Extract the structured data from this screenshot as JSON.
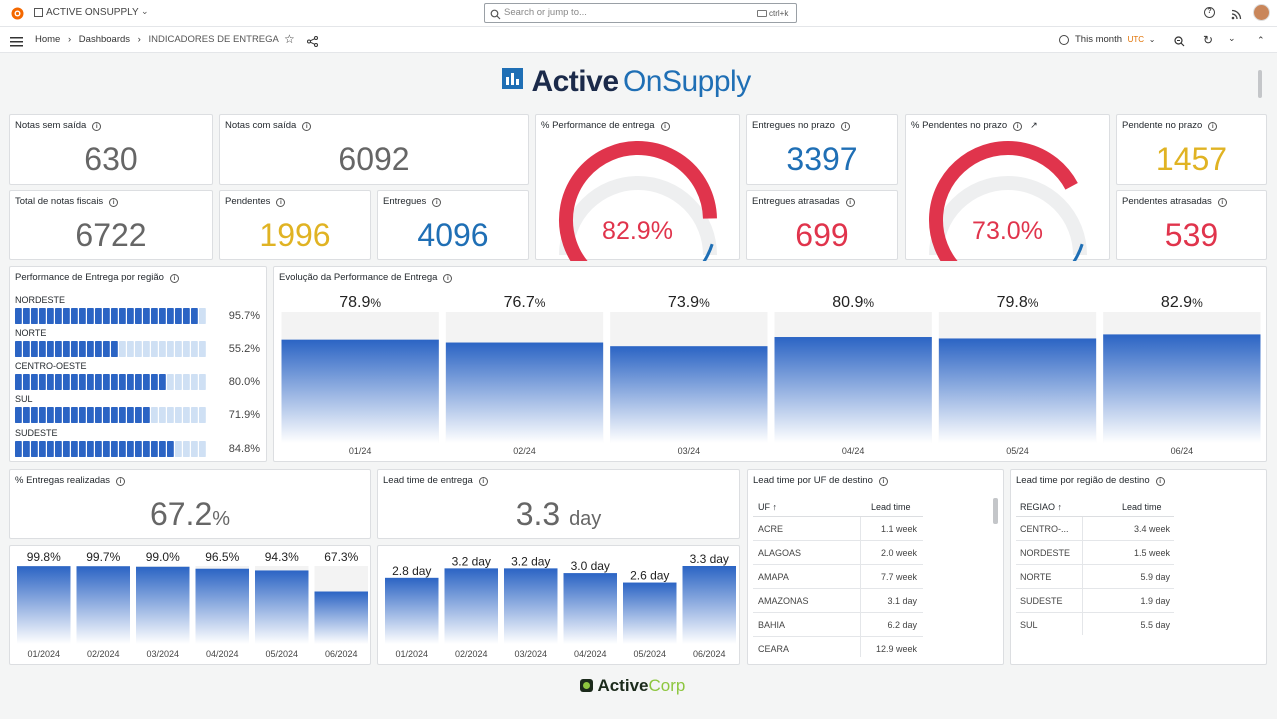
{
  "topbar": {
    "app_title": "ACTIVE ONSUPPLY",
    "search_placeholder": "Search or jump to...",
    "search_shortcut": "ctrl+k"
  },
  "navbar": {
    "breadcrumb": [
      "Home",
      "Dashboards",
      "INDICADORES DE ENTREGA"
    ],
    "time_range": "This month",
    "timezone": "UTC"
  },
  "header_logo": {
    "word1": "Active",
    "word2": "OnSupply"
  },
  "footer_logo": {
    "word1": "Active",
    "word2": "Corp"
  },
  "stats": {
    "notas_sem_saida": {
      "title": "Notas sem saída",
      "value": "630"
    },
    "notas_com_saida": {
      "title": "Notas com saída",
      "value": "6092"
    },
    "total_notas": {
      "title": "Total de notas fiscais",
      "value": "6722"
    },
    "pendentes": {
      "title": "Pendentes",
      "value": "1996"
    },
    "entregues": {
      "title": "Entregues",
      "value": "4096"
    },
    "entregues_no_prazo": {
      "title": "Entregues no prazo",
      "value": "3397"
    },
    "entregues_atrasadas": {
      "title": "Entregues atrasadas",
      "value": "699"
    },
    "pendente_no_prazo": {
      "title": "Pendente no prazo",
      "value": "1457"
    },
    "pendentes_atrasadas": {
      "title": "Pendentes atrasadas",
      "value": "539"
    },
    "entregas_realizadas": {
      "title": "% Entregas realizadas",
      "value": "67.2",
      "unit": "%"
    },
    "lead_time": {
      "title": "Lead time de entrega",
      "value": "3.3",
      "unit": "day"
    }
  },
  "gauges": {
    "performance": {
      "title": "% Performance de entrega",
      "value": 82.9,
      "label": "82.9%"
    },
    "pendentes_prazo": {
      "title": "% Pendentes no prazo",
      "value": 73.0,
      "label": "73.0%"
    }
  },
  "colors": {
    "blue": "#1f6fb5",
    "yellow": "#e0b323",
    "red": "#e0344c",
    "bar_blue": "#2b64c4"
  },
  "regiao_panel": {
    "title": "Performance de Entrega por região",
    "items": [
      {
        "label": "NORDESTE",
        "value": 95.7,
        "text": "95.7%"
      },
      {
        "label": "NORTE",
        "value": 55.2,
        "text": "55.2%"
      },
      {
        "label": "CENTRO-OESTE",
        "value": 80.0,
        "text": "80.0%"
      },
      {
        "label": "SUL",
        "value": 71.9,
        "text": "71.9%"
      },
      {
        "label": "SUDESTE",
        "value": 84.8,
        "text": "84.8%"
      }
    ]
  },
  "chart_data": [
    {
      "type": "bar",
      "title": "Evolução da Performance de Entrega",
      "categories": [
        "01/24",
        "02/24",
        "03/24",
        "04/24",
        "05/24",
        "06/24"
      ],
      "values": [
        78.9,
        76.7,
        73.9,
        80.9,
        79.8,
        82.9
      ],
      "labels": [
        "78.9",
        "76.7",
        "73.9",
        "80.9",
        "79.8",
        "82.9"
      ],
      "unit": "%",
      "ylim": [
        0,
        100
      ]
    },
    {
      "type": "bar",
      "categories": [
        "01/2024",
        "02/2024",
        "03/2024",
        "04/2024",
        "05/2024",
        "06/2024"
      ],
      "values": [
        99.8,
        99.7,
        99.0,
        96.5,
        94.3,
        67.3
      ],
      "labels": [
        "99.8%",
        "99.7%",
        "99.0%",
        "96.5%",
        "94.3%",
        "67.3%"
      ],
      "ylim": [
        0,
        100
      ]
    },
    {
      "type": "bar",
      "categories": [
        "01/2024",
        "02/2024",
        "03/2024",
        "04/2024",
        "05/2024",
        "06/2024"
      ],
      "values": [
        2.8,
        3.2,
        3.2,
        3.0,
        2.6,
        3.3
      ],
      "labels": [
        "2.8 day",
        "3.2 day",
        "3.2 day",
        "3.0 day",
        "2.6 day",
        "3.3 day"
      ],
      "ylim": [
        0,
        3.3
      ]
    }
  ],
  "uf_table": {
    "title": "Lead time por UF de destino",
    "col1": "UF",
    "col2": "Lead time",
    "rows": [
      [
        "ACRE",
        "1.1 week"
      ],
      [
        "ALAGOAS",
        "2.0 week"
      ],
      [
        "AMAPA",
        "7.7 week"
      ],
      [
        "AMAZONAS",
        "3.1 day"
      ],
      [
        "BAHIA",
        "6.2 day"
      ],
      [
        "CEARA",
        "12.9 week"
      ]
    ]
  },
  "regiao_table": {
    "title": "Lead time por região de destino",
    "col1": "REGIAO",
    "col2": "Lead time",
    "rows": [
      [
        "CENTRO-...",
        "3.4 week"
      ],
      [
        "NORDESTE",
        "1.5 week"
      ],
      [
        "NORTE",
        "5.9 day"
      ],
      [
        "SUDESTE",
        "1.9 day"
      ],
      [
        "SUL",
        "5.5 day"
      ]
    ]
  }
}
